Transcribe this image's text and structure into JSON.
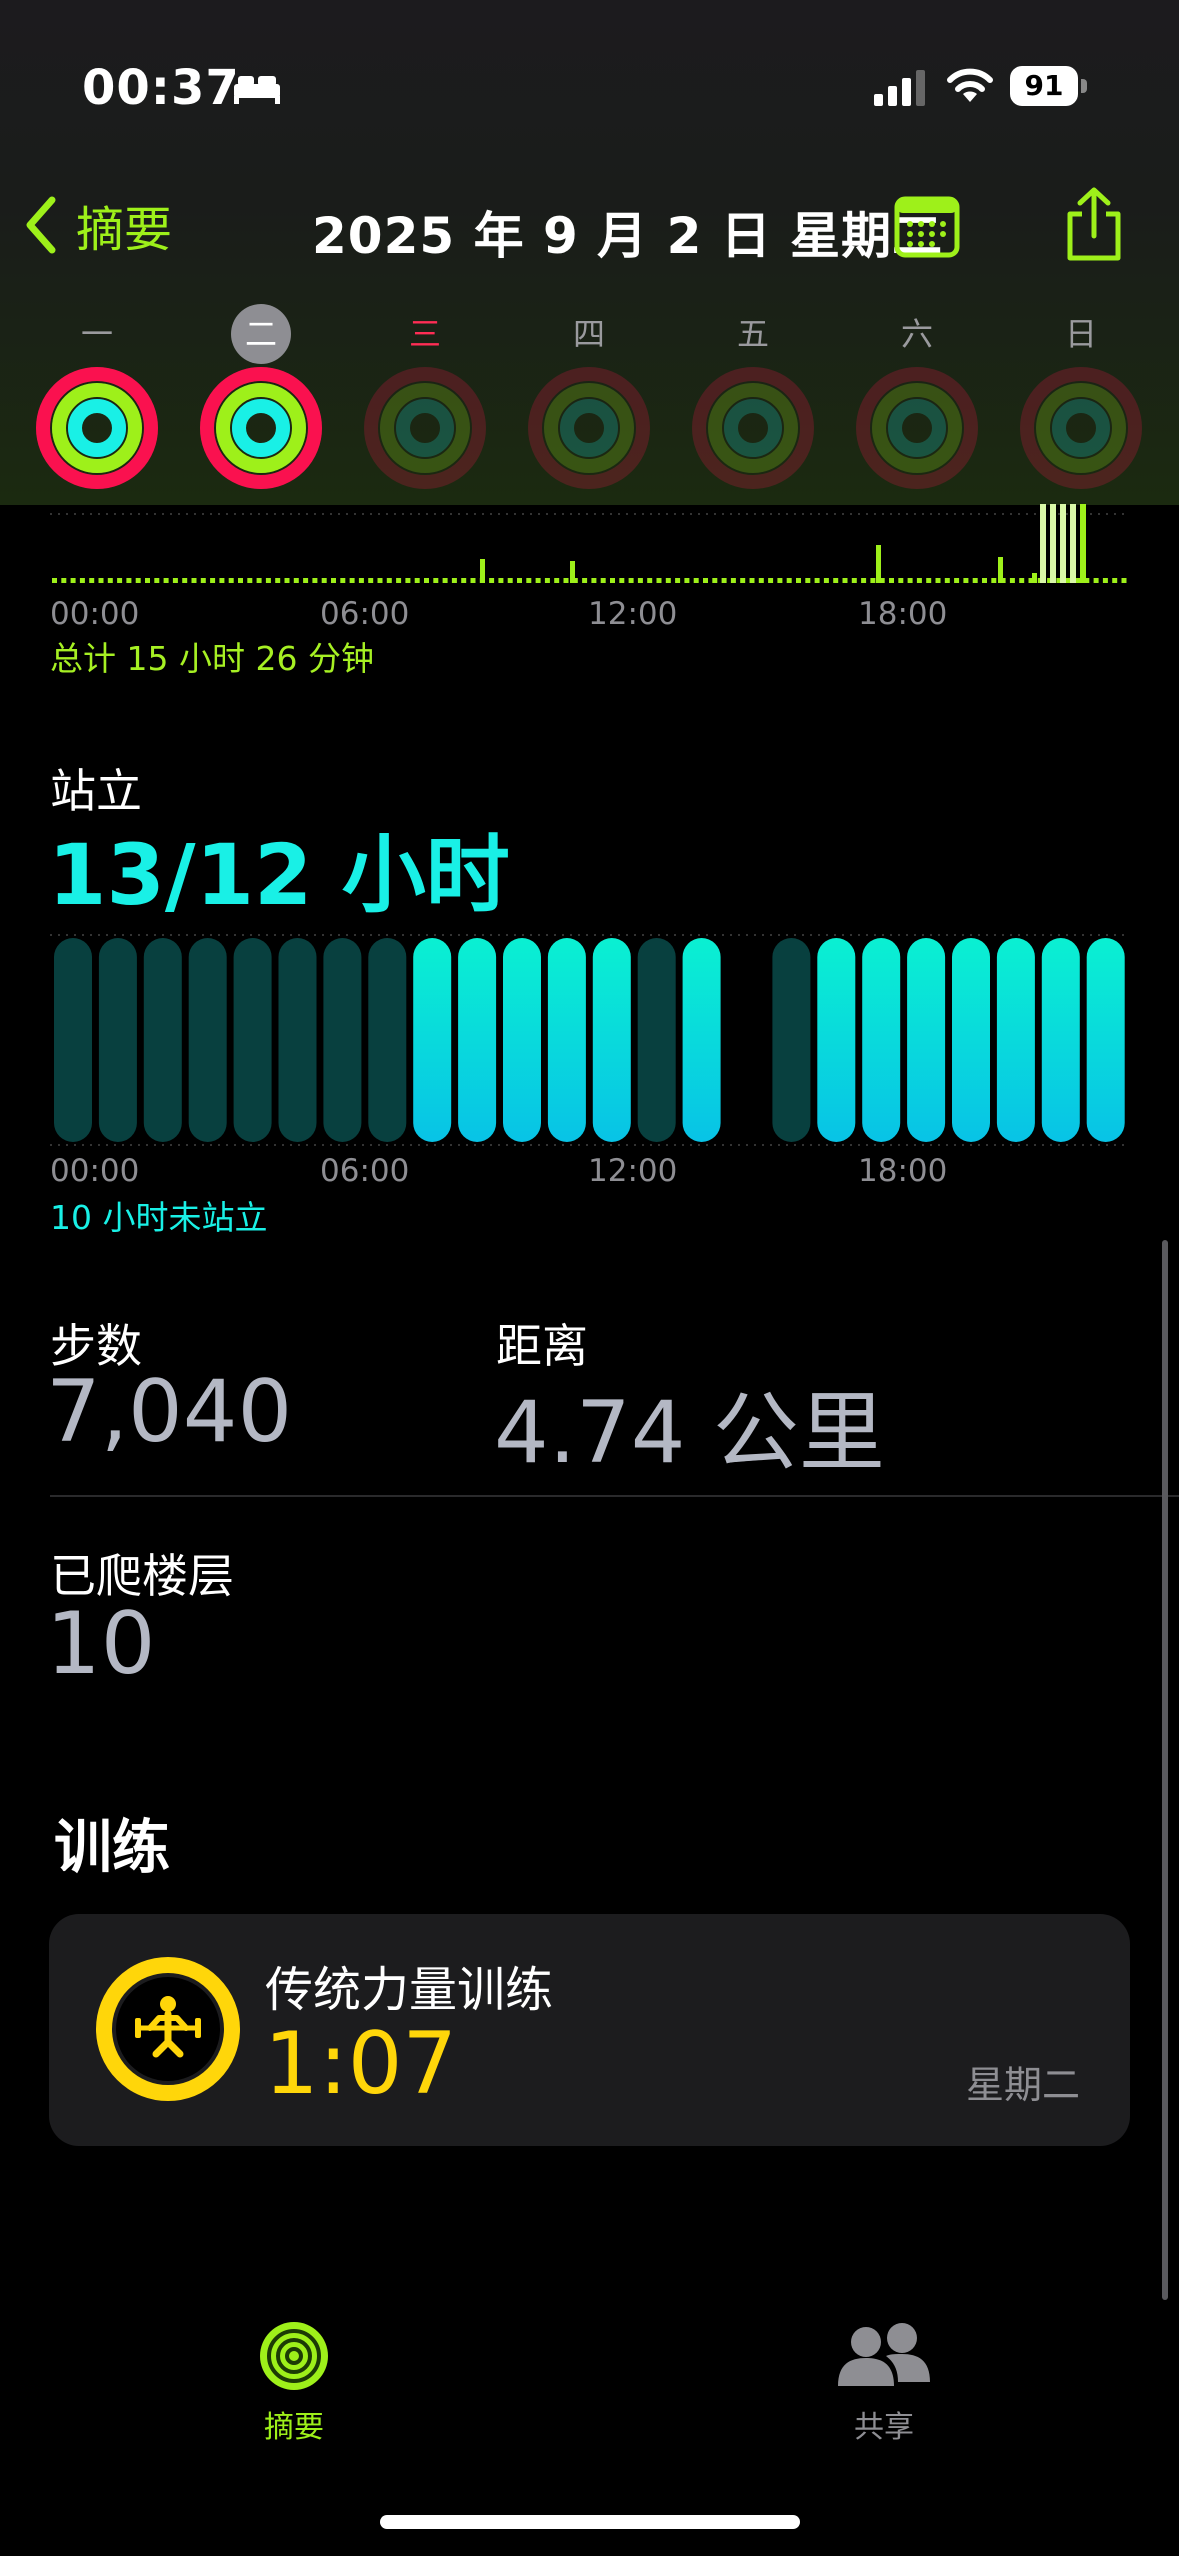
{
  "status_bar": {
    "time": "00:37",
    "battery": "91"
  },
  "nav": {
    "back_label": "摘要",
    "title": "2025 年 9 月 2 日 星期二"
  },
  "week": {
    "days": [
      "一",
      "二",
      "三",
      "四",
      "五",
      "六",
      "日"
    ],
    "selected_index": 1,
    "today_index": 2
  },
  "colors": {
    "move": "#fa114f",
    "exercise": "#9ef01a",
    "stand": "#19f0e6",
    "accent": "#a6f023",
    "workout": "#ffd60a"
  },
  "move_hourly": {
    "time_labels": [
      "00:00",
      "06:00",
      "12:00",
      "18:00"
    ],
    "total": "总计 15 小时 26 分钟"
  },
  "stand": {
    "title": "站立",
    "value": "13/12 小时",
    "hours_stood": [
      false,
      false,
      false,
      false,
      false,
      false,
      false,
      false,
      true,
      true,
      true,
      true,
      true,
      false,
      true,
      null,
      false,
      true,
      true,
      true,
      true,
      true,
      true,
      true
    ],
    "time_labels": [
      "00:00",
      "06:00",
      "12:00",
      "18:00"
    ],
    "note": "10 小时未站立"
  },
  "metrics": {
    "steps_label": "步数",
    "steps_value": "7,040",
    "distance_label": "距离",
    "distance_value": "4.74 公里",
    "floors_label": "已爬楼层",
    "floors_value": "10"
  },
  "workouts": {
    "heading": "训练",
    "items": [
      {
        "name": "传统力量训练",
        "duration": "1:07",
        "day": "星期二",
        "icon": "strength-training-icon"
      }
    ]
  },
  "tabs": [
    {
      "label": "摘要",
      "icon": "activity-rings-icon",
      "active": true
    },
    {
      "label": "共享",
      "icon": "people-icon",
      "active": false
    }
  ]
}
